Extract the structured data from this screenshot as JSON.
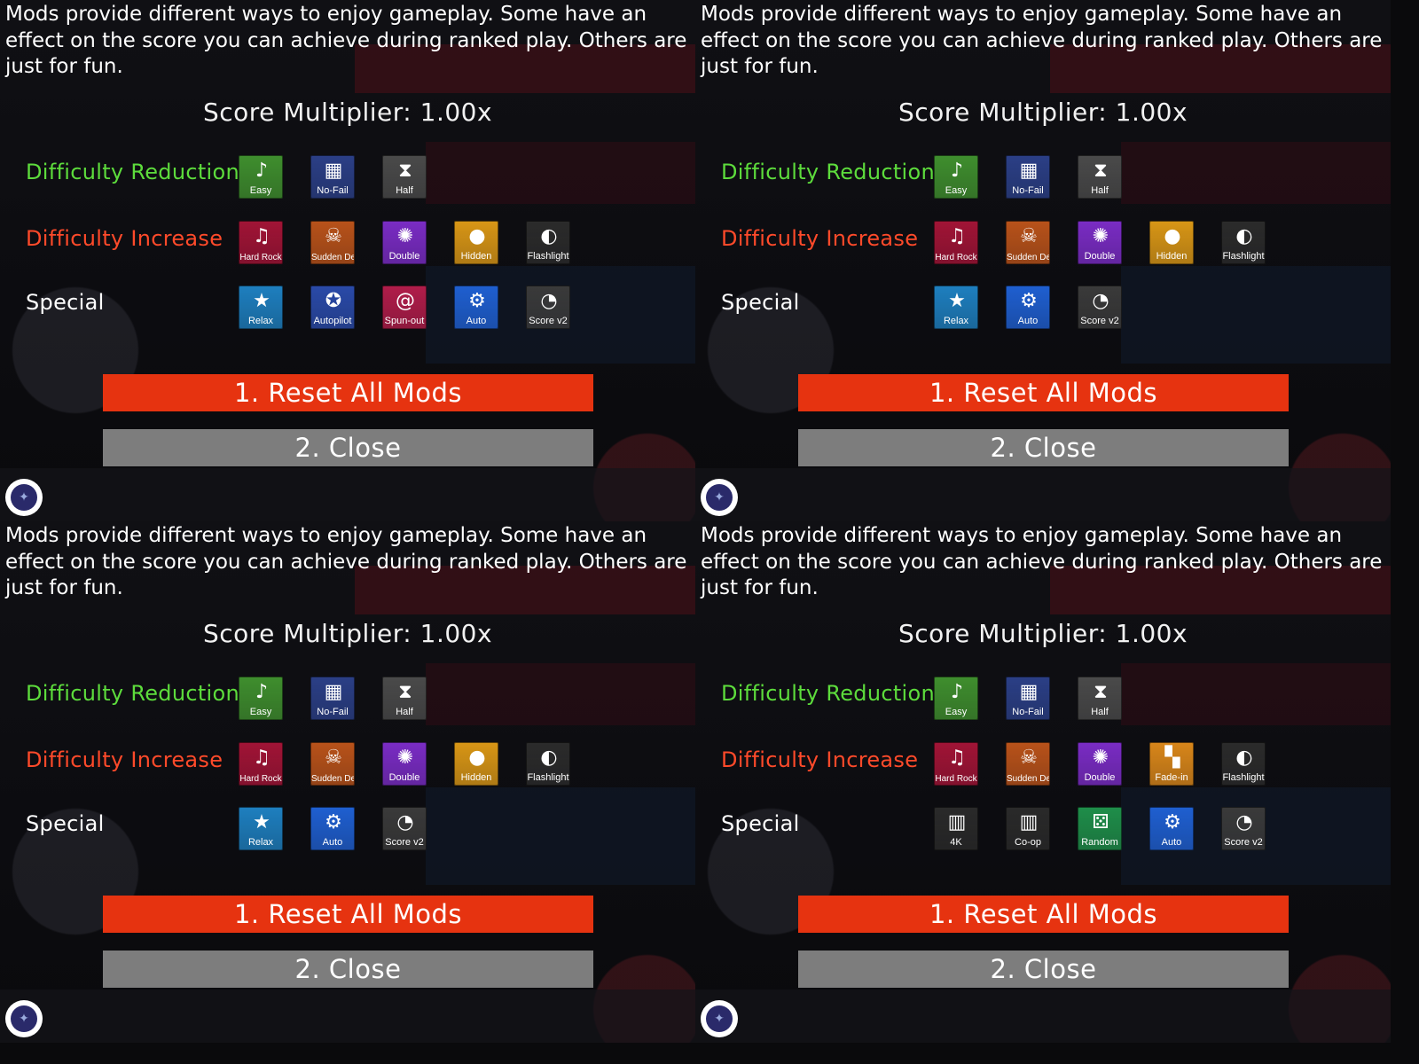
{
  "colors": {
    "reduction": "#5ddc3c",
    "increase": "#ff4a2a",
    "reset_button": "#e63310",
    "close_button": "#7d7d7d"
  },
  "panels": [
    {
      "description": "Mods provide different ways to enjoy gameplay. Some have an effect on the score you can achieve during ranked play. Others are just for fun.",
      "multiplier": "Score Multiplier: 1.00x",
      "reduction_label": "Difficulty Reduction",
      "increase_label": "Difficulty Increase",
      "special_label": "Special",
      "reduction": [
        {
          "name": "Easy",
          "icon": "music-note-icon",
          "color": "#3f8e2e"
        },
        {
          "name": "No-Fail",
          "icon": "net-icon",
          "color": "#2b3f86"
        },
        {
          "name": "Half",
          "icon": "hourglass-icon",
          "color": "#4a4a4a"
        }
      ],
      "increase": [
        {
          "name": "Hard Rock",
          "icon": "notes-icon",
          "color": "#a11436"
        },
        {
          "name": "Sudden Death",
          "icon": "skull-icon",
          "color": "#b8521a"
        },
        {
          "name": "Double",
          "icon": "burst-icon",
          "color": "#7a2cc4"
        },
        {
          "name": "Hidden",
          "icon": "coin-icon",
          "color": "#d89616"
        },
        {
          "name": "Flashlight",
          "icon": "moon-icon",
          "color": "#2b2b2b"
        }
      ],
      "special": [
        {
          "name": "Relax",
          "icon": "star-icon",
          "color": "#1e7fbf"
        },
        {
          "name": "Autopilot",
          "icon": "compass-star-icon",
          "color": "#2a4aa8"
        },
        {
          "name": "Spun-out",
          "icon": "spiral-icon",
          "color": "#b01d4a"
        },
        {
          "name": "Auto",
          "icon": "gear-icon",
          "color": "#1f5fd0"
        },
        {
          "name": "Score v2",
          "icon": "gauge-icon",
          "color": "#3a3a3a"
        }
      ],
      "reset_label": "1. Reset All Mods",
      "close_label": "2. Close"
    },
    {
      "description": "Mods provide different ways to enjoy gameplay. Some have an effect on the score you can achieve during ranked play. Others are just for fun.",
      "multiplier": "Score Multiplier: 1.00x",
      "reduction_label": "Difficulty Reduction",
      "increase_label": "Difficulty Increase",
      "special_label": "Special",
      "reduction": [
        {
          "name": "Easy",
          "icon": "music-note-icon",
          "color": "#3f8e2e"
        },
        {
          "name": "No-Fail",
          "icon": "net-icon",
          "color": "#2b3f86"
        },
        {
          "name": "Half",
          "icon": "hourglass-icon",
          "color": "#4a4a4a"
        }
      ],
      "increase": [
        {
          "name": "Hard Rock",
          "icon": "notes-icon",
          "color": "#a11436"
        },
        {
          "name": "Sudden Death",
          "icon": "skull-icon",
          "color": "#b8521a"
        },
        {
          "name": "Double",
          "icon": "burst-icon",
          "color": "#7a2cc4"
        },
        {
          "name": "Hidden",
          "icon": "coin-icon",
          "color": "#d89616"
        },
        {
          "name": "Flashlight",
          "icon": "moon-icon",
          "color": "#2b2b2b"
        }
      ],
      "special": [
        {
          "name": "Relax",
          "icon": "star-icon",
          "color": "#1e7fbf"
        },
        {
          "name": "Auto",
          "icon": "gear-icon",
          "color": "#1f5fd0"
        },
        {
          "name": "Score v2",
          "icon": "gauge-icon",
          "color": "#3a3a3a"
        }
      ],
      "reset_label": "1. Reset All Mods",
      "close_label": "2. Close"
    },
    {
      "description": "Mods provide different ways to enjoy gameplay. Some have an effect on the score you can achieve during ranked play. Others are just for fun.",
      "multiplier": "Score Multiplier: 1.00x",
      "reduction_label": "Difficulty Reduction",
      "increase_label": "Difficulty Increase",
      "special_label": "Special",
      "reduction": [
        {
          "name": "Easy",
          "icon": "music-note-icon",
          "color": "#3f8e2e"
        },
        {
          "name": "No-Fail",
          "icon": "net-icon",
          "color": "#2b3f86"
        },
        {
          "name": "Half",
          "icon": "hourglass-icon",
          "color": "#4a4a4a"
        }
      ],
      "increase": [
        {
          "name": "Hard Rock",
          "icon": "notes-icon",
          "color": "#a11436"
        },
        {
          "name": "Sudden Death",
          "icon": "skull-icon",
          "color": "#b8521a"
        },
        {
          "name": "Double",
          "icon": "burst-icon",
          "color": "#7a2cc4"
        },
        {
          "name": "Hidden",
          "icon": "coin-icon",
          "color": "#d89616"
        },
        {
          "name": "Flashlight",
          "icon": "moon-icon",
          "color": "#2b2b2b"
        }
      ],
      "special": [
        {
          "name": "Relax",
          "icon": "star-icon",
          "color": "#1e7fbf"
        },
        {
          "name": "Auto",
          "icon": "gear-icon",
          "color": "#1f5fd0"
        },
        {
          "name": "Score v2",
          "icon": "gauge-icon",
          "color": "#3a3a3a"
        }
      ],
      "reset_label": "1. Reset All Mods",
      "close_label": "2. Close"
    },
    {
      "description": "Mods provide different ways to enjoy gameplay. Some have an effect on the score you can achieve during ranked play. Others are just for fun.",
      "multiplier": "Score Multiplier: 1.00x",
      "reduction_label": "Difficulty Reduction",
      "increase_label": "Difficulty Increase",
      "special_label": "Special",
      "reduction": [
        {
          "name": "Easy",
          "icon": "music-note-icon",
          "color": "#3f8e2e"
        },
        {
          "name": "No-Fail",
          "icon": "net-icon",
          "color": "#2b3f86"
        },
        {
          "name": "Half",
          "icon": "hourglass-icon",
          "color": "#4a4a4a"
        }
      ],
      "increase": [
        {
          "name": "Hard Rock",
          "icon": "notes-icon",
          "color": "#a11436"
        },
        {
          "name": "Sudden Death",
          "icon": "skull-icon",
          "color": "#b8521a"
        },
        {
          "name": "Double",
          "icon": "burst-icon",
          "color": "#7a2cc4"
        },
        {
          "name": "Fade-in",
          "icon": "fade-blocks-icon",
          "color": "#d8861a"
        },
        {
          "name": "Flashlight",
          "icon": "moon-icon",
          "color": "#2b2b2b"
        }
      ],
      "special": [
        {
          "name": "4K",
          "icon": "piano-keys-icon",
          "color": "#2a2a2a"
        },
        {
          "name": "Co-op",
          "icon": "piano-keys-icon",
          "color": "#2a2a2a"
        },
        {
          "name": "Random",
          "icon": "dice-icon",
          "color": "#1f8e4a"
        },
        {
          "name": "Auto",
          "icon": "gear-icon",
          "color": "#1f5fd0"
        },
        {
          "name": "Score v2",
          "icon": "gauge-icon",
          "color": "#3a3a3a"
        }
      ],
      "reset_label": "1. Reset All Mods",
      "close_label": "2. Close"
    }
  ]
}
